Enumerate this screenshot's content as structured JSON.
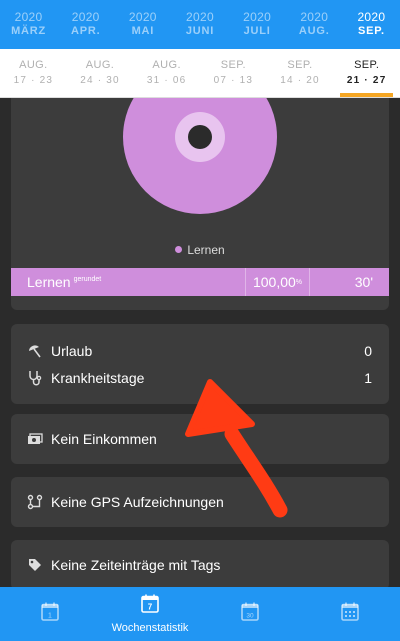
{
  "months": [
    {
      "year": "2020",
      "month": "MÄRZ",
      "active": false
    },
    {
      "year": "2020",
      "month": "APR.",
      "active": false
    },
    {
      "year": "2020",
      "month": "MAI",
      "active": false
    },
    {
      "year": "2020",
      "month": "JUNI",
      "active": false
    },
    {
      "year": "2020",
      "month": "JULI",
      "active": false
    },
    {
      "year": "2020",
      "month": "AUG.",
      "active": false
    },
    {
      "year": "2020",
      "month": "SEP.",
      "active": true
    }
  ],
  "weeks": [
    {
      "month": "AUG.",
      "days": "17 · 23"
    },
    {
      "month": "AUG.",
      "days": "24 · 30"
    },
    {
      "month": "AUG.",
      "days": "31 · 06"
    },
    {
      "month": "SEP.",
      "days": "07 · 13"
    },
    {
      "month": "SEP.",
      "days": "14 · 20"
    },
    {
      "month": "SEP.",
      "days": "21 · 27"
    }
  ],
  "chart": {
    "legend_label": "Lernen",
    "color": "#cf8edc",
    "summary": {
      "name": "Lernen",
      "note": "gerundet",
      "percent": "100,00",
      "percent_sign": "%",
      "time": "30'"
    }
  },
  "absence": {
    "vacation_label": "Urlaub",
    "vacation_value": "0",
    "sick_label": "Krankheitstage",
    "sick_value": "1"
  },
  "income": {
    "label": "Kein Einkommen"
  },
  "gps": {
    "label": "Keine GPS Aufzeichnungen"
  },
  "tags": {
    "label": "Keine Zeiteinträge mit Tags"
  },
  "bottom_nav": {
    "day_num": "1",
    "week_num": "7",
    "week_label": "Wochenstatistik",
    "month_num": "30"
  },
  "colors": {
    "primary": "#2196f3",
    "accent": "#f5a623",
    "series": "#cf8edc",
    "annotation": "#ff3b14"
  }
}
